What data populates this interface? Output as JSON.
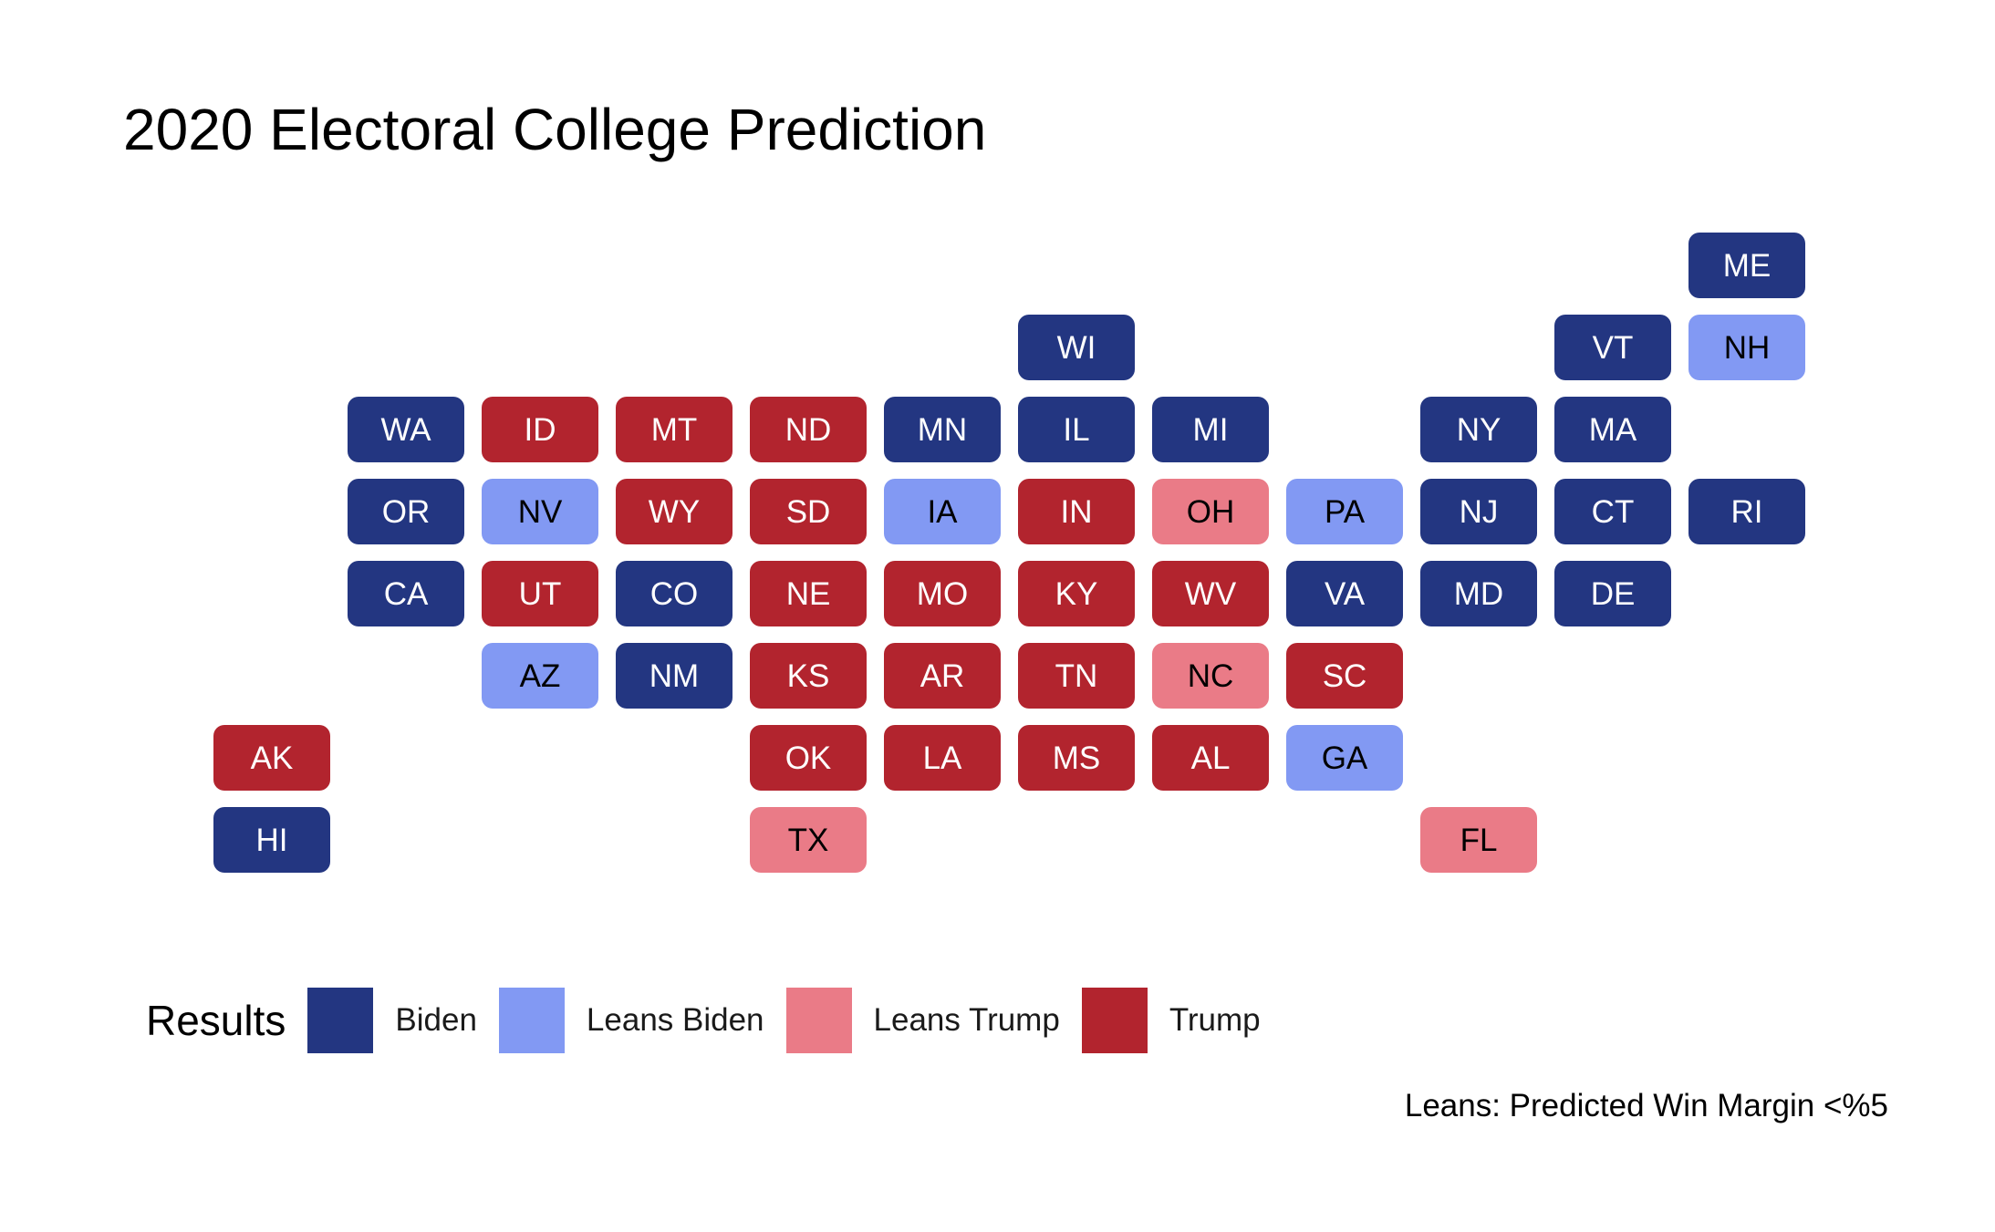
{
  "title": "2020 Electoral College Prediction",
  "colors": {
    "Biden": "#233681",
    "Leans Biden": "#8299f3",
    "Leans Trump": "#ea7b87",
    "Trump": "#b2242e"
  },
  "text_colors": {
    "Biden": "#ffffff",
    "Leans Biden": "#000000",
    "Leans Trump": "#000000",
    "Trump": "#ffffff"
  },
  "legend": {
    "title": "Results",
    "items": [
      {
        "key": "Biden",
        "label": "Biden"
      },
      {
        "key": "Leans Biden",
        "label": "Leans Biden"
      },
      {
        "key": "Leans Trump",
        "label": "Leans Trump"
      },
      {
        "key": "Trump",
        "label": "Trump"
      }
    ]
  },
  "caption": "Leans: Predicted Win Margin <%5",
  "chart_data": {
    "type": "tile-grid",
    "states": [
      {
        "state": "ME",
        "col": 11,
        "row": 0,
        "result": "Biden"
      },
      {
        "state": "WI",
        "col": 6,
        "row": 1,
        "result": "Biden"
      },
      {
        "state": "VT",
        "col": 10,
        "row": 1,
        "result": "Biden"
      },
      {
        "state": "NH",
        "col": 11,
        "row": 1,
        "result": "Leans Biden"
      },
      {
        "state": "WA",
        "col": 1,
        "row": 2,
        "result": "Biden"
      },
      {
        "state": "ID",
        "col": 2,
        "row": 2,
        "result": "Trump"
      },
      {
        "state": "MT",
        "col": 3,
        "row": 2,
        "result": "Trump"
      },
      {
        "state": "ND",
        "col": 4,
        "row": 2,
        "result": "Trump"
      },
      {
        "state": "MN",
        "col": 5,
        "row": 2,
        "result": "Biden"
      },
      {
        "state": "IL",
        "col": 6,
        "row": 2,
        "result": "Biden"
      },
      {
        "state": "MI",
        "col": 7,
        "row": 2,
        "result": "Biden"
      },
      {
        "state": "NY",
        "col": 9,
        "row": 2,
        "result": "Biden"
      },
      {
        "state": "MA",
        "col": 10,
        "row": 2,
        "result": "Biden"
      },
      {
        "state": "OR",
        "col": 1,
        "row": 3,
        "result": "Biden"
      },
      {
        "state": "NV",
        "col": 2,
        "row": 3,
        "result": "Leans Biden"
      },
      {
        "state": "WY",
        "col": 3,
        "row": 3,
        "result": "Trump"
      },
      {
        "state": "SD",
        "col": 4,
        "row": 3,
        "result": "Trump"
      },
      {
        "state": "IA",
        "col": 5,
        "row": 3,
        "result": "Leans Biden"
      },
      {
        "state": "IN",
        "col": 6,
        "row": 3,
        "result": "Trump"
      },
      {
        "state": "OH",
        "col": 7,
        "row": 3,
        "result": "Leans Trump"
      },
      {
        "state": "PA",
        "col": 8,
        "row": 3,
        "result": "Leans Biden"
      },
      {
        "state": "NJ",
        "col": 9,
        "row": 3,
        "result": "Biden"
      },
      {
        "state": "CT",
        "col": 10,
        "row": 3,
        "result": "Biden"
      },
      {
        "state": "RI",
        "col": 11,
        "row": 3,
        "result": "Biden"
      },
      {
        "state": "CA",
        "col": 1,
        "row": 4,
        "result": "Biden"
      },
      {
        "state": "UT",
        "col": 2,
        "row": 4,
        "result": "Trump"
      },
      {
        "state": "CO",
        "col": 3,
        "row": 4,
        "result": "Biden"
      },
      {
        "state": "NE",
        "col": 4,
        "row": 4,
        "result": "Trump"
      },
      {
        "state": "MO",
        "col": 5,
        "row": 4,
        "result": "Trump"
      },
      {
        "state": "KY",
        "col": 6,
        "row": 4,
        "result": "Trump"
      },
      {
        "state": "WV",
        "col": 7,
        "row": 4,
        "result": "Trump"
      },
      {
        "state": "VA",
        "col": 8,
        "row": 4,
        "result": "Biden"
      },
      {
        "state": "MD",
        "col": 9,
        "row": 4,
        "result": "Biden"
      },
      {
        "state": "DE",
        "col": 10,
        "row": 4,
        "result": "Biden"
      },
      {
        "state": "AZ",
        "col": 2,
        "row": 5,
        "result": "Leans Biden"
      },
      {
        "state": "NM",
        "col": 3,
        "row": 5,
        "result": "Biden"
      },
      {
        "state": "KS",
        "col": 4,
        "row": 5,
        "result": "Trump"
      },
      {
        "state": "AR",
        "col": 5,
        "row": 5,
        "result": "Trump"
      },
      {
        "state": "TN",
        "col": 6,
        "row": 5,
        "result": "Trump"
      },
      {
        "state": "NC",
        "col": 7,
        "row": 5,
        "result": "Leans Trump"
      },
      {
        "state": "SC",
        "col": 8,
        "row": 5,
        "result": "Trump"
      },
      {
        "state": "AK",
        "col": 0,
        "row": 6,
        "result": "Trump"
      },
      {
        "state": "OK",
        "col": 4,
        "row": 6,
        "result": "Trump"
      },
      {
        "state": "LA",
        "col": 5,
        "row": 6,
        "result": "Trump"
      },
      {
        "state": "MS",
        "col": 6,
        "row": 6,
        "result": "Trump"
      },
      {
        "state": "AL",
        "col": 7,
        "row": 6,
        "result": "Trump"
      },
      {
        "state": "GA",
        "col": 8,
        "row": 6,
        "result": "Leans Biden"
      },
      {
        "state": "HI",
        "col": 0,
        "row": 7,
        "result": "Biden"
      },
      {
        "state": "TX",
        "col": 4,
        "row": 7,
        "result": "Leans Trump"
      },
      {
        "state": "FL",
        "col": 9,
        "row": 7,
        "result": "Leans Trump"
      }
    ]
  }
}
